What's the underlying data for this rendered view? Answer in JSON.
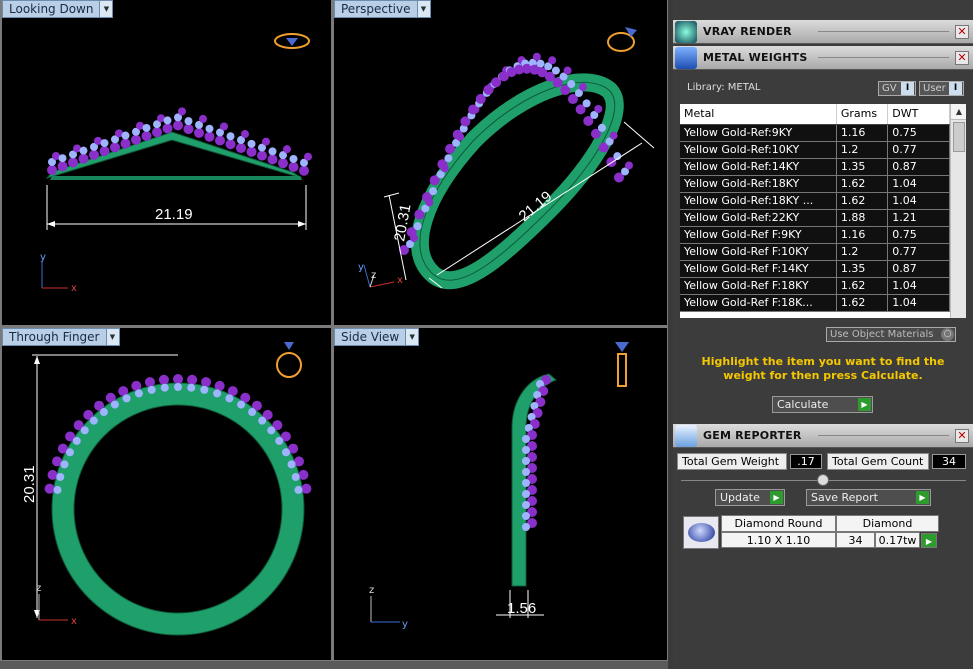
{
  "viewports": {
    "top_left": {
      "label": "Looking Down",
      "dimension": "21.19",
      "axis_y": "y",
      "axis_x": "x"
    },
    "top_right": {
      "label": "Perspective",
      "dimension_a": "21.19",
      "dimension_b": "20.31",
      "axis_y": "y",
      "axis_z": "z",
      "axis_x": "x"
    },
    "bottom_left": {
      "label": "Through Finger",
      "dimension": "20.31",
      "axis_z": "z",
      "axis_x": "x"
    },
    "bottom_right": {
      "label": "Side View",
      "dimension": "1.56",
      "axis_z": "z",
      "axis_y": "y"
    }
  },
  "panels": {
    "vray": {
      "title": "VRAY RENDER"
    },
    "metal": {
      "title": "METAL WEIGHTS",
      "library_label": "Library: METAL",
      "gv_label": "GV",
      "user_label": "User",
      "columns": [
        "Metal",
        "Grams",
        "DWT"
      ],
      "rows": [
        [
          "Yellow Gold-Ref:9KY",
          "1.16",
          "0.75"
        ],
        [
          "Yellow Gold-Ref:10KY",
          "1.2",
          "0.77"
        ],
        [
          "Yellow Gold-Ref:14KY",
          "1.35",
          "0.87"
        ],
        [
          "Yellow Gold-Ref:18KY",
          "1.62",
          "1.04"
        ],
        [
          "Yellow Gold-Ref:18KY ...",
          "1.62",
          "1.04"
        ],
        [
          "Yellow Gold-Ref:22KY",
          "1.88",
          "1.21"
        ],
        [
          "Yellow Gold-Ref F:9KY",
          "1.16",
          "0.75"
        ],
        [
          "Yellow Gold-Ref F:10KY",
          "1.2",
          "0.77"
        ],
        [
          "Yellow Gold-Ref F:14KY",
          "1.35",
          "0.87"
        ],
        [
          "Yellow Gold-Ref F:18KY",
          "1.62",
          "1.04"
        ],
        [
          "Yellow Gold-Ref F:18K...",
          "1.62",
          "1.04"
        ]
      ],
      "use_object_materials": "Use Object Materials",
      "instruction": "Highlight the item you want to find the weight for then press Calculate.",
      "calculate_label": "Calculate"
    },
    "gem": {
      "title": "GEM REPORTER",
      "total_weight_label": "Total Gem Weight",
      "total_weight_value": ".17",
      "total_count_label": "Total Gem Count",
      "total_count_value": "34",
      "update_label": "Update",
      "save_label": "Save Report",
      "gem_name": "Diamond Round",
      "gem_size": "1.10 X 1.10",
      "gem_type": "Diamond",
      "gem_count": "34",
      "gem_weight": "0.17tw"
    }
  },
  "colors": {
    "band": "#1fa06a",
    "stone_purple": "#8a2fc9",
    "stone_blue": "#9fb4ff",
    "highlight_text": "#f5c800"
  }
}
